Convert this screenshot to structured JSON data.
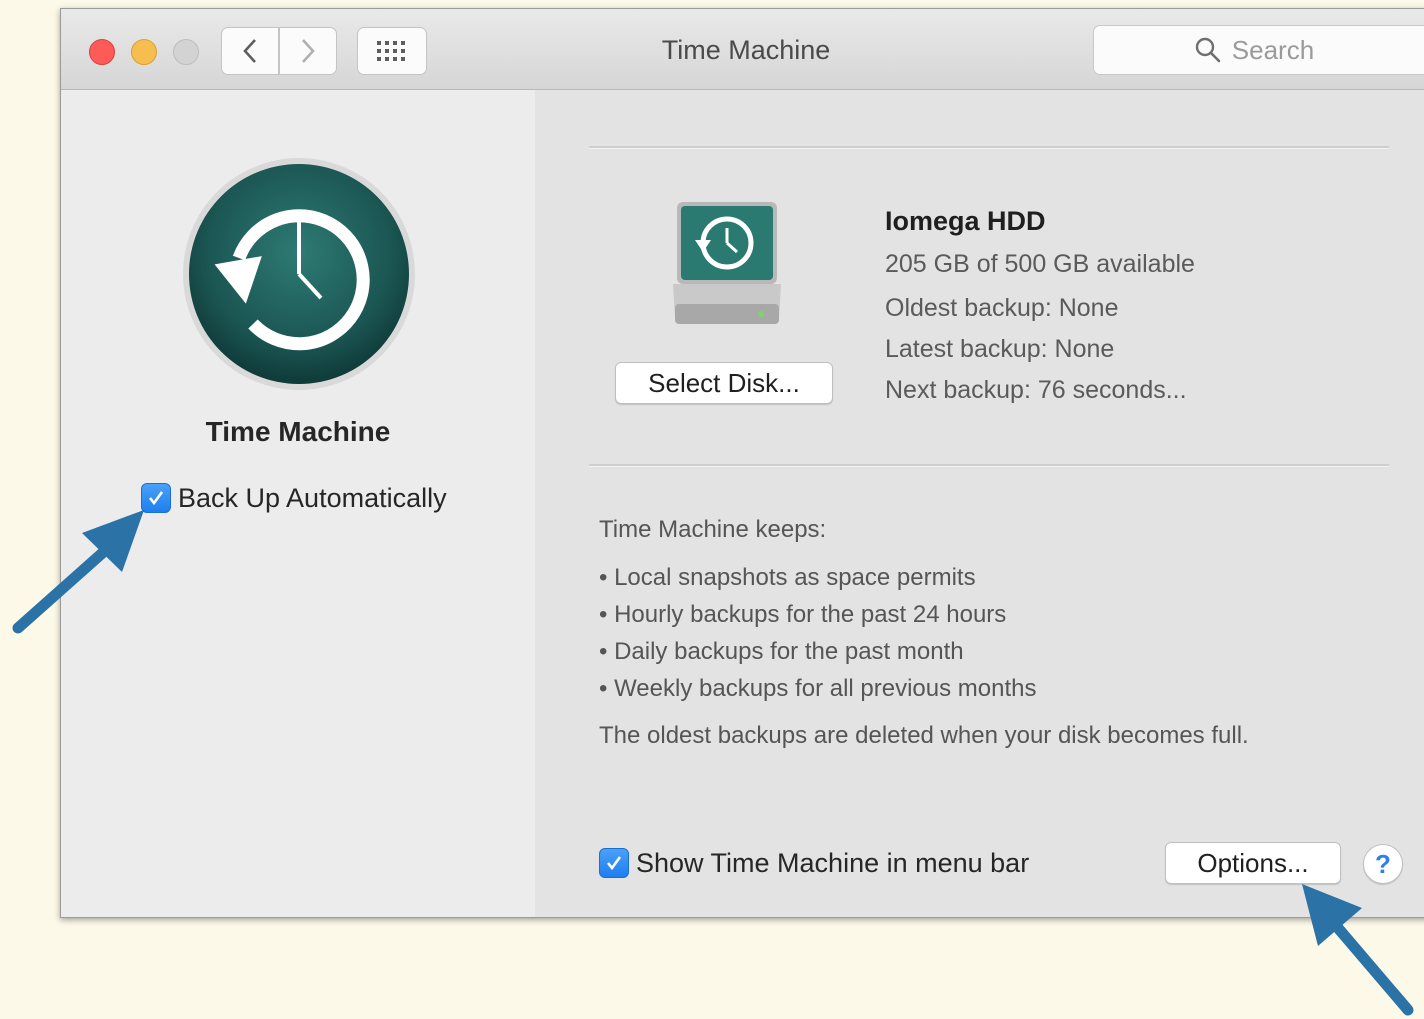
{
  "window": {
    "title": "Time Machine",
    "search_placeholder": "Search"
  },
  "toolbar": {
    "back_icon": "chevron-left-icon",
    "forward_icon": "chevron-right-icon",
    "grid_icon": "grid-icon"
  },
  "left_pane": {
    "app_name": "Time Machine",
    "backup_auto_label": "Back Up Automatically",
    "backup_auto_checked": true
  },
  "disk": {
    "select_button": "Select Disk...",
    "name": "Iomega HDD",
    "available": "205 GB of 500 GB available",
    "oldest_backup": "Oldest backup: None",
    "latest_backup": "Latest backup: None",
    "next_backup": "Next backup: 76 seconds..."
  },
  "keeps": {
    "heading": "Time Machine keeps:",
    "items": [
      "Local snapshots as space permits",
      "Hourly backups for the past 24 hours",
      "Daily backups for the past month",
      "Weekly backups for all previous months"
    ],
    "footer": "The oldest backups are deleted when your disk becomes full."
  },
  "bottom": {
    "menubar_label": "Show Time Machine in menu bar",
    "menubar_checked": true,
    "options_button": "Options...",
    "help_button": "?"
  },
  "colors": {
    "accent": "#1e7ef0",
    "arrow": "#2b72a7",
    "icon_teal": "#1f5a57",
    "background": "#fdf9e9"
  }
}
